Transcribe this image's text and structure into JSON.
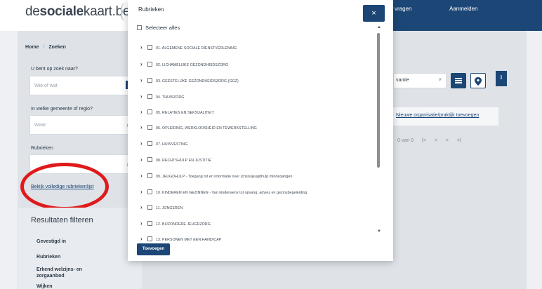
{
  "header": {
    "logo_prefix": "de",
    "logo_bold": "sociale",
    "logo_suffix": "kaart.be",
    "nav_questions": "vragen",
    "nav_login": "Aanmelden"
  },
  "breadcrumb": {
    "home": "Home",
    "separator": "/",
    "current": "Zoeken"
  },
  "search": {
    "what_label": "U bent op zoek naar?",
    "what_placeholder": "Wie of wat",
    "where_label": "In welke gemeente of regio?",
    "where_placeholder": "Waar",
    "rubrieken_label": "Rubrieken",
    "full_list_link": "Bekijk volledige rubriekenlijst"
  },
  "filters": {
    "title": "Resultaten filteren",
    "items": [
      "Gevestigd in",
      "Rubrieken",
      "Erkend welzijns- en",
      "zorgaanbod",
      "Wijken"
    ]
  },
  "results": {
    "sort_value": "vantie",
    "new_org_link": "Nieuwe organisatie/praktijk toevoegen",
    "pager_count": "0 van 0",
    "pager_symbols": [
      "|<",
      "<",
      ">",
      ">|"
    ],
    "info_label": "i"
  },
  "modal": {
    "title": "Rubrieken",
    "close": "×",
    "select_all": "Selecteer alles",
    "add_button": "Toevoegen",
    "items": [
      "01. ALGEMENE SOCIALE DIENSTVERLENING",
      "02. LICHAMELIJKE GEZONDHEIDSZORG",
      "03. GEESTELIJKE GEZONDHEIDSZORG (GGZ)",
      "04. THUISZORG",
      "05. RELATIES EN SEKSUALITEIT",
      "06. OPLEIDING, WERKLOOSHEID EN TEWERKSTELLING",
      "07. HUISVESTING",
      "08. RECHTSHULP EN JUSTITIE",
      "09. JEUGDHULP - Toegang tot en informatie over (crisis)jeugdhulp minderjarigen",
      "10. KINDEREN EN GEZINNEN - Van kinderwens tot opvang, advies en gezinsbegeleiding",
      "11. JONGEREN",
      "12. BIJZONDERE JEUGDZORG",
      "13. PERSONEN MET EEN HANDICAP"
    ]
  },
  "colors": {
    "brand": "#1b4675",
    "highlight": "#e01a1a"
  }
}
